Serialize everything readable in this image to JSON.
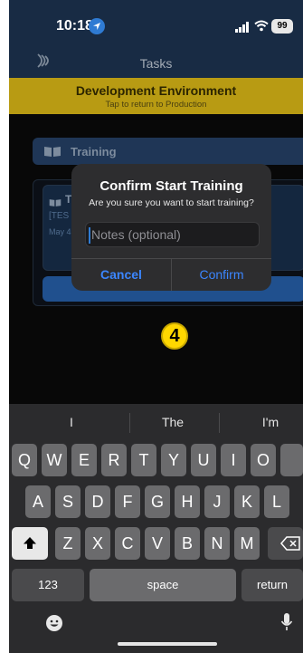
{
  "status_bar": {
    "time": "10:18",
    "battery": "99"
  },
  "nav": {
    "title": "Tasks"
  },
  "dev_banner": {
    "title": "Development Environment",
    "subtitle": "Tap to return to Production"
  },
  "background": {
    "section_label": "Training",
    "card": {
      "title_fragment": "T",
      "test_fragment": "[TES",
      "date_fragment": "May 4"
    }
  },
  "alert": {
    "title": "Confirm Start Training",
    "message": "Are you sure you want to start training?",
    "input_placeholder": "Notes (optional)",
    "cancel_label": "Cancel",
    "confirm_label": "Confirm"
  },
  "step_badge": "4",
  "keyboard": {
    "suggestions": [
      "I",
      "The",
      "I'm"
    ],
    "row1": [
      "Q",
      "W",
      "E",
      "R",
      "T",
      "Y",
      "U",
      "I",
      "O"
    ],
    "row2": [
      "A",
      "S",
      "D",
      "F",
      "G",
      "H",
      "J",
      "K",
      "L"
    ],
    "row3": [
      "Z",
      "X",
      "C",
      "V",
      "B",
      "N",
      "M"
    ],
    "numbers_label": "123",
    "space_label": "space",
    "return_label": "return"
  }
}
